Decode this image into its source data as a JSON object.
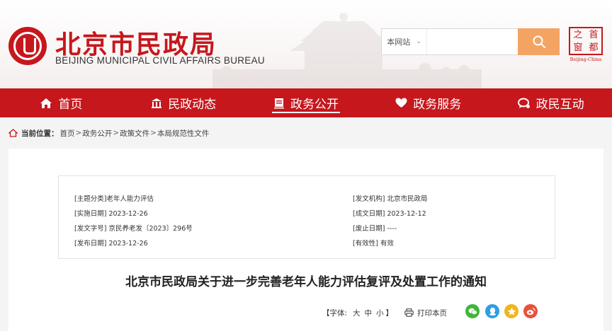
{
  "header": {
    "title": "北京市民政局",
    "subtitle": "BEIJING MUNICIPAL CIVIL AFFAIRS BUREAU"
  },
  "search": {
    "scope": "本网站",
    "placeholder": ""
  },
  "beijing_logo": {
    "chars": [
      "之",
      "首",
      "窗",
      "都"
    ],
    "caption": "Beijing-China"
  },
  "nav": {
    "items": [
      {
        "label": "首页",
        "icon": "home-icon"
      },
      {
        "label": "民政动态",
        "icon": "building-icon"
      },
      {
        "label": "政务公开",
        "icon": "document-icon"
      },
      {
        "label": "政务服务",
        "icon": "heart-icon"
      },
      {
        "label": "政民互动",
        "icon": "chat-icon"
      }
    ],
    "active_index": 2
  },
  "breadcrumb": {
    "label": "当前位置：",
    "items": [
      "首页",
      "政务公开",
      "政策文件",
      "本局规范性文件"
    ],
    "separator": ">"
  },
  "doc_info": {
    "topic_label": "[主题分类]",
    "topic_value": "老年人能力评估",
    "effective_label": "[实施日期]",
    "effective_value": "2023-12-26",
    "number_label": "[发文字号]",
    "number_value": "京民养老发〔2023〕296号",
    "publish_label": "[发布日期]",
    "publish_value": "2023-12-26",
    "issuer_label": "[发文机构]",
    "issuer_value": "北京市民政局",
    "created_label": "[成文日期]",
    "created_value": "2023-12-12",
    "abolish_label": "[废止日期]",
    "abolish_value": "----",
    "validity_label": "[有效性]",
    "validity_value": "有效"
  },
  "document": {
    "title": "北京市民政局关于进一步完善老年人能力评估复评及处置工作的通知"
  },
  "tools": {
    "font_label": "【字体:",
    "size_large": "大",
    "size_medium": "中",
    "size_small": "小",
    "font_close": "】",
    "print_label": "打印本页"
  },
  "share": [
    {
      "name": "wechat",
      "color": "#3fb63a"
    },
    {
      "name": "qq",
      "color": "#2f9ee0"
    },
    {
      "name": "qzone",
      "color": "#f1b51c"
    },
    {
      "name": "weibo",
      "color": "#e8513b"
    }
  ],
  "colors": {
    "brand_red": "#c6171d",
    "search_orange": "#f4a462"
  }
}
